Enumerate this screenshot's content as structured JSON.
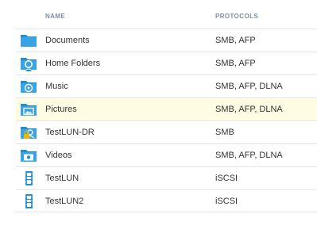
{
  "columns": {
    "name": "NAME",
    "protocols": "PROTOCOLS"
  },
  "rows": [
    {
      "name": "Documents",
      "protocols": "SMB, AFP",
      "icon": "folder-icon",
      "selected": false
    },
    {
      "name": "Home Folders",
      "protocols": "SMB, AFP",
      "icon": "home-folder-icon",
      "selected": false
    },
    {
      "name": "Music",
      "protocols": "SMB, AFP, DLNA",
      "icon": "music-folder-icon",
      "selected": false
    },
    {
      "name": "Pictures",
      "protocols": "SMB, AFP, DLNA",
      "icon": "picture-folder-icon",
      "selected": true
    },
    {
      "name": "TestLUN-DR",
      "protocols": "SMB",
      "icon": "locked-folder-icon",
      "selected": false
    },
    {
      "name": "Videos",
      "protocols": "SMB, AFP, DLNA",
      "icon": "video-folder-icon",
      "selected": false
    },
    {
      "name": "TestLUN",
      "protocols": "iSCSI",
      "icon": "iscsi-lun-icon",
      "selected": false
    },
    {
      "name": "TestLUN2",
      "protocols": "iSCSI",
      "icon": "iscsi-lun-icon",
      "selected": false
    }
  ],
  "colors": {
    "accent": "#1f8fd4",
    "selected_row": "#fefde3",
    "header_text": "#7f8ea6",
    "lock": "#f1b400"
  }
}
